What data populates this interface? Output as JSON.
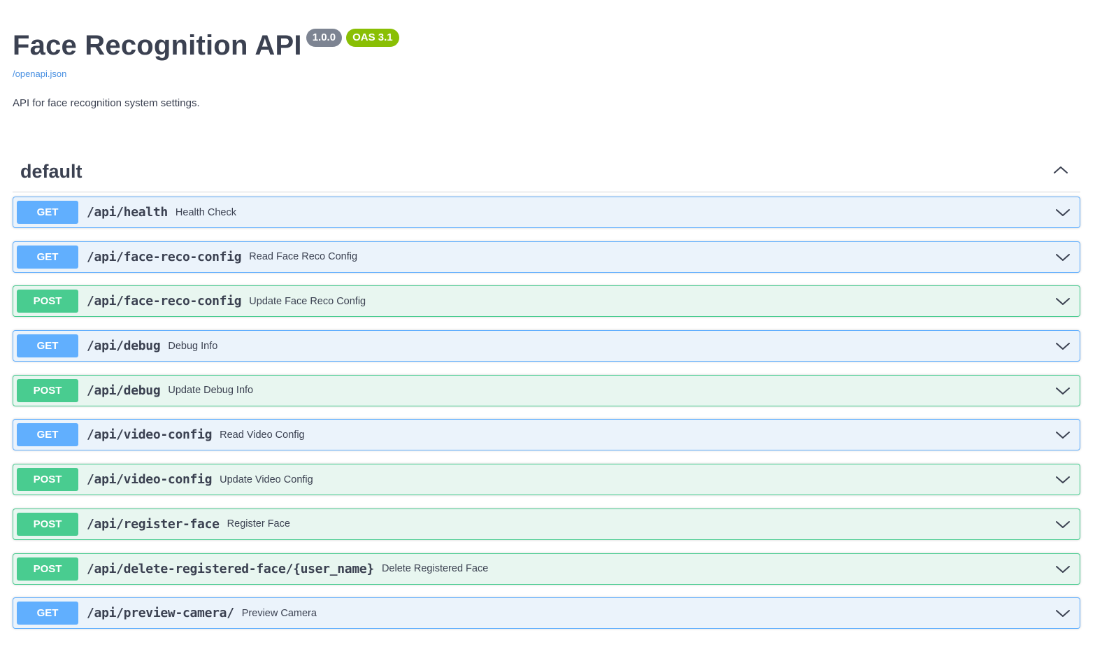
{
  "info": {
    "title": "Face Recognition API",
    "version": "1.0.0",
    "oas": "OAS 3.1",
    "spec_link": "/openapi.json",
    "description": "API for face recognition system settings."
  },
  "section": {
    "title": "default",
    "expanded": true
  },
  "operations": [
    {
      "method": "GET",
      "path": "/api/health",
      "summary": "Health Check"
    },
    {
      "method": "GET",
      "path": "/api/face-reco-config",
      "summary": "Read Face Reco Config"
    },
    {
      "method": "POST",
      "path": "/api/face-reco-config",
      "summary": "Update Face Reco Config"
    },
    {
      "method": "GET",
      "path": "/api/debug",
      "summary": "Debug Info"
    },
    {
      "method": "POST",
      "path": "/api/debug",
      "summary": "Update Debug Info"
    },
    {
      "method": "GET",
      "path": "/api/video-config",
      "summary": "Read Video Config"
    },
    {
      "method": "POST",
      "path": "/api/video-config",
      "summary": "Update Video Config"
    },
    {
      "method": "POST",
      "path": "/api/register-face",
      "summary": "Register Face"
    },
    {
      "method": "POST",
      "path": "/api/delete-registered-face/{user_name}",
      "summary": "Delete Registered Face"
    },
    {
      "method": "GET",
      "path": "/api/preview-camera/",
      "summary": "Preview Camera"
    }
  ],
  "colors": {
    "get": "#61affe",
    "post": "#49cc90",
    "version_badge": "#7d8492",
    "oas_badge": "#89bf04",
    "link": "#4990e2"
  },
  "icons": {
    "section_toggle": "chevron-up-icon",
    "operation_toggle": "chevron-down-icon"
  }
}
